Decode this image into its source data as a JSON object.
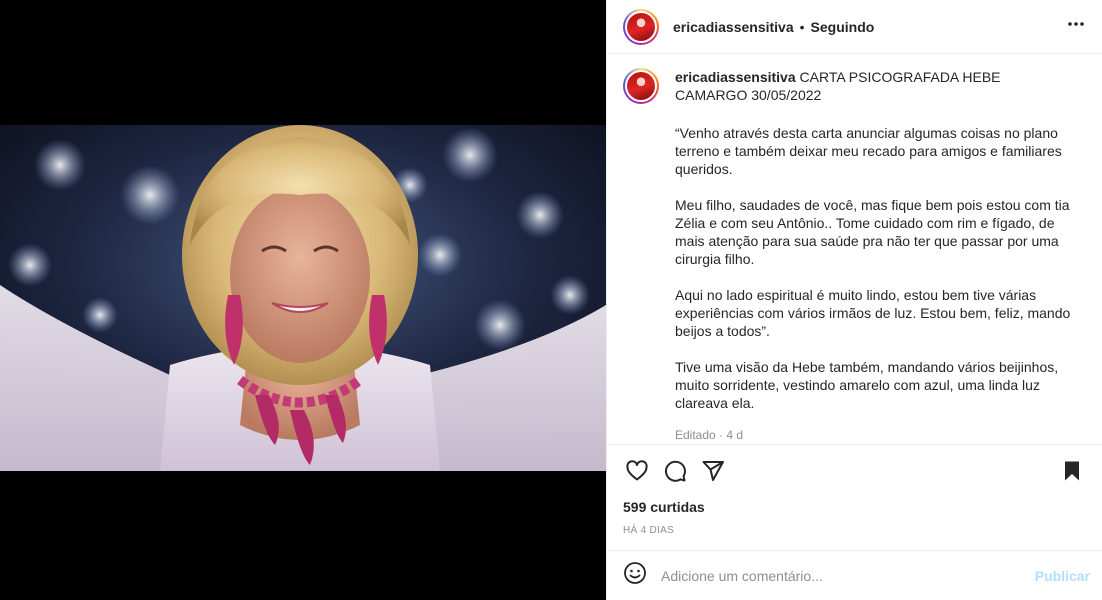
{
  "post": {
    "username": "ericadiassensitiva",
    "separator": "•",
    "follow_status": "Seguindo",
    "more_icon": "more-horizontal-icon"
  },
  "caption": {
    "username": "ericadiassensitiva",
    "title": "CARTA PSICOGRAFADA HEBE CAMARGO 30/05/2022",
    "paragraphs": [
      "“Venho através desta carta anunciar algumas coisas no plano terreno e também deixar meu recado para amigos e familiares queridos.",
      "Meu filho, saudades de você, mas fique bem pois estou com tia Zélia e com seu Antônio.. Tome cuidado com rim e fígado, de mais atenção para sua saúde pra não ter que passar por uma cirurgia filho.",
      "Aqui no lado espiritual é muito lindo, estou bem tive várias experiências com vários irmãos de luz. Estou bem, feliz, mando beijos a todos”.",
      "Tive uma visão da Hebe também, mandando vários beijinhos, muito sorridente, vestindo amarelo com azul, uma linda luz clareava ela."
    ],
    "edited": "Editado · 4 d"
  },
  "actions": {
    "likes": "599 curtidas",
    "time": "HÁ 4 DIAS"
  },
  "comment": {
    "placeholder": "Adicione um comentário...",
    "publish_label": "Publicar"
  },
  "colors": {
    "accent_disabled": "#b2dffc",
    "text": "#262626",
    "muted": "#8e8e8e",
    "border": "#efefef"
  }
}
